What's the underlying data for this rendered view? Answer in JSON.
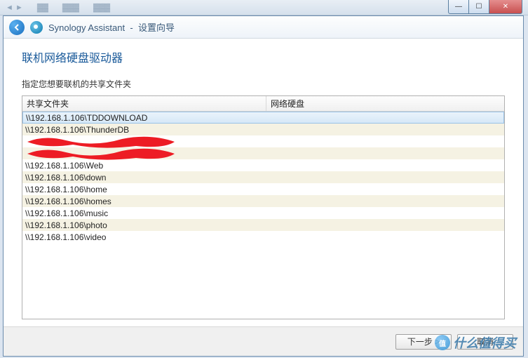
{
  "window_controls": {
    "minimize_label": "—",
    "maximize_label": "☐",
    "close_label": "✕"
  },
  "header": {
    "app_name": "Synology Assistant",
    "separator": "-",
    "wizard_title": "设置向导"
  },
  "content": {
    "section_title": "联机网络硬盘驱动器",
    "instruction": "指定您想要联机的共享文件夹"
  },
  "table": {
    "columns": [
      "共享文件夹",
      "网络硬盘"
    ],
    "rows": [
      {
        "path": "\\\\192.168.1.106\\TDDOWNLOAD",
        "drive": "",
        "selected": true,
        "redacted": false
      },
      {
        "path": "\\\\192.168.1.106\\ThunderDB",
        "drive": "",
        "selected": false,
        "redacted": false
      },
      {
        "path": "",
        "drive": "",
        "selected": false,
        "redacted": true
      },
      {
        "path": "",
        "drive": "",
        "selected": false,
        "redacted": true
      },
      {
        "path": "\\\\192.168.1.106\\Web",
        "drive": "",
        "selected": false,
        "redacted": false
      },
      {
        "path": "\\\\192.168.1.106\\down",
        "drive": "",
        "selected": false,
        "redacted": false
      },
      {
        "path": "\\\\192.168.1.106\\home",
        "drive": "",
        "selected": false,
        "redacted": false
      },
      {
        "path": "\\\\192.168.1.106\\homes",
        "drive": "",
        "selected": false,
        "redacted": false
      },
      {
        "path": "\\\\192.168.1.106\\music",
        "drive": "",
        "selected": false,
        "redacted": false
      },
      {
        "path": "\\\\192.168.1.106\\photo",
        "drive": "",
        "selected": false,
        "redacted": false
      },
      {
        "path": "\\\\192.168.1.106\\video",
        "drive": "",
        "selected": false,
        "redacted": false
      }
    ]
  },
  "footer": {
    "next_label": "下一步",
    "cancel_label": "取消"
  },
  "watermark": {
    "text": "什么值得买"
  }
}
